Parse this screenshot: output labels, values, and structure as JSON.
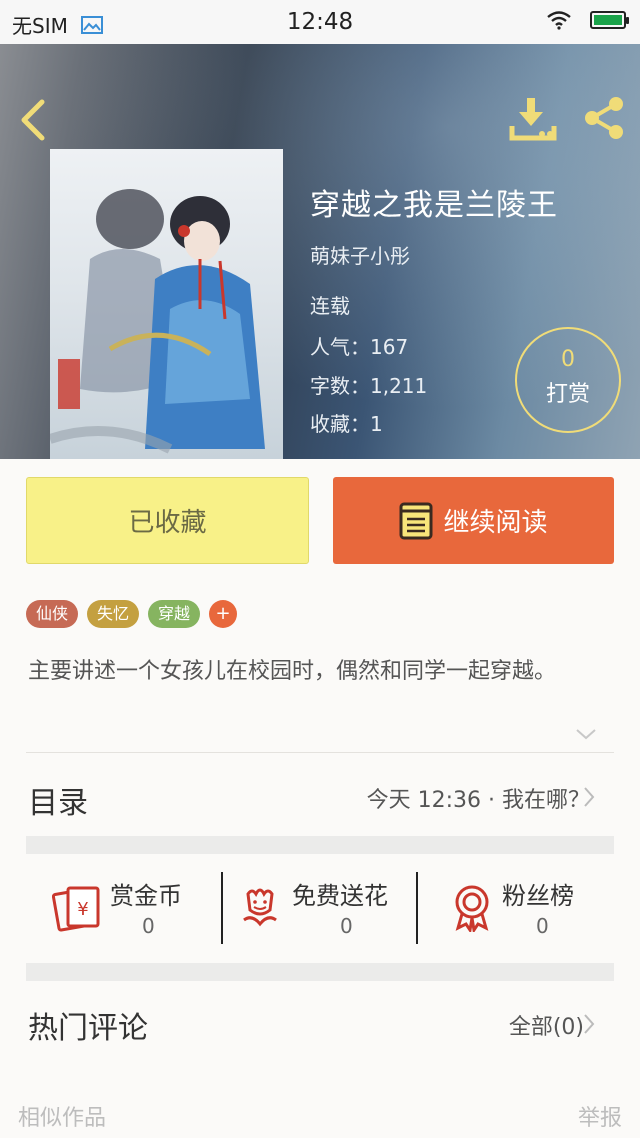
{
  "status_bar": {
    "carrier": "无SIM",
    "time": "12:48"
  },
  "book": {
    "title": "穿越之我是兰陵王",
    "author": "萌妹子小彤",
    "status": "连载",
    "popularity": "人气：167",
    "word_count": "字数：1,211",
    "favorites": "收藏：1"
  },
  "reward": {
    "count": "0",
    "label": "打赏"
  },
  "actions": {
    "collected": "已收藏",
    "continue_reading": "继续阅读"
  },
  "tags": [
    {
      "label": "仙侠",
      "color": "#c66a55"
    },
    {
      "label": "失忆",
      "color": "#c4a040"
    },
    {
      "label": "穿越",
      "color": "#86b460"
    }
  ],
  "tag_add": "+",
  "description": "主要讲述一个女孩儿在校园时，偶然和同学一起穿越。",
  "catalog": {
    "label": "目录",
    "latest_update": "今天 12:36 · 我在哪？"
  },
  "stats": [
    {
      "label": "赏金币",
      "value": "0",
      "icon": "red-envelope-icon"
    },
    {
      "label": "免费送花",
      "value": "0",
      "icon": "flower-icon"
    },
    {
      "label": "粉丝榜",
      "value": "0",
      "icon": "medal-icon"
    }
  ],
  "comments": {
    "label": "热门评论",
    "all": "全部(0)"
  },
  "footer": {
    "similar": "相似作品",
    "report": "举报"
  },
  "colors": {
    "accent": "#e8683c",
    "collected_bg": "#f8f188",
    "reward_gold": "#f0dc78",
    "icon_red": "#c9372c"
  }
}
